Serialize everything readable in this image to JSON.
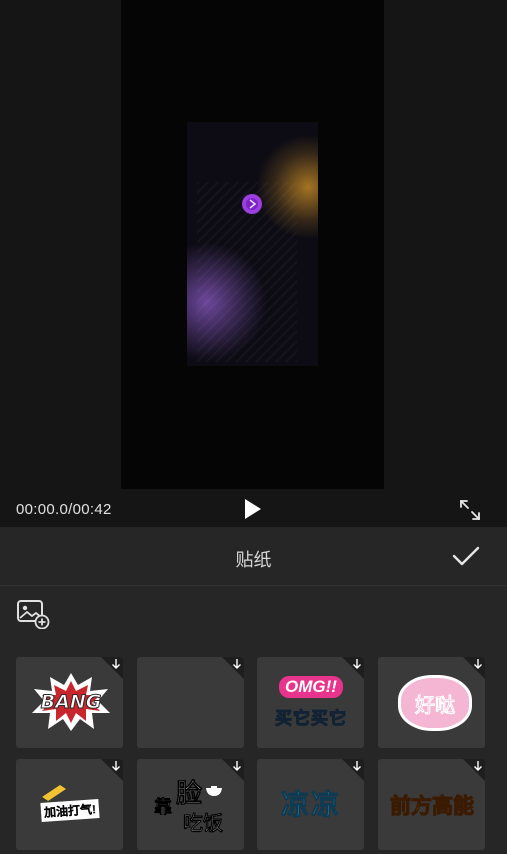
{
  "player": {
    "time": "00:00.0/00:42"
  },
  "panel": {
    "title": "贴纸"
  },
  "stickers": [
    {
      "text": "BANG"
    },
    {
      "text": ""
    },
    {
      "text_top": "OMG!!",
      "text_bottom": "买它买它"
    },
    {
      "text": "好哒"
    },
    {
      "text": "加油打气!"
    },
    {
      "text_a": "靠",
      "text_b": "脸",
      "text_c": "吃饭"
    },
    {
      "text": "凉凉"
    },
    {
      "text": "前方高能"
    }
  ],
  "icons": {
    "play": "play-icon",
    "fullscreen": "fullscreen-icon",
    "confirm": "checkmark-icon",
    "upload": "image-add-icon",
    "download": "download-arrow-icon"
  },
  "colors": {
    "background": "#151515",
    "panel": "#262626",
    "tile": "#3a3a3a",
    "accent_pink": "#e8348c",
    "accent_cyan": "#3fd0e0",
    "accent_yellow": "#f2c230"
  }
}
